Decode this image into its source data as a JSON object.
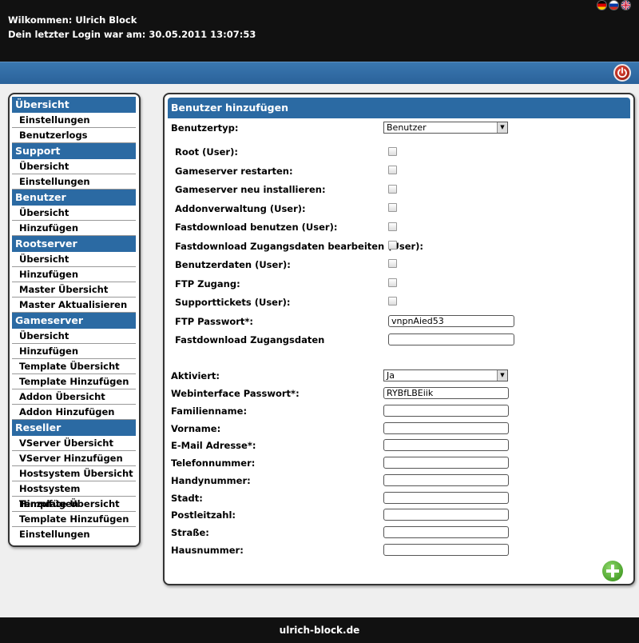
{
  "header": {
    "welcome": "Wilkommen: Ulrich Block",
    "last_login": "Dein letzter Login war am: 30.05.2011 13:07:53"
  },
  "sidebar": {
    "sections": [
      {
        "title": "Übersicht",
        "items": [
          "Einstellungen",
          "Benutzerlogs"
        ]
      },
      {
        "title": "Support",
        "items": [
          "Übersicht",
          "Einstellungen"
        ]
      },
      {
        "title": "Benutzer",
        "items": [
          "Übersicht",
          "Hinzufügen"
        ]
      },
      {
        "title": "Rootserver",
        "items": [
          "Übersicht",
          "Hinzufügen",
          "Master Übersicht",
          "Master Aktualisieren"
        ]
      },
      {
        "title": "Gameserver",
        "items": [
          "Übersicht",
          "Hinzufügen",
          "Template Übersicht",
          "Template Hinzufügen",
          "Addon Übersicht",
          "Addon Hinzufügen"
        ]
      },
      {
        "title": "Reseller",
        "items": [
          "VServer Übersicht",
          "VServer Hinzufügen",
          "Hostsystem Übersicht",
          "Hostsystem Hinzufügen",
          "Template Übersicht",
          "Template Hinzufügen",
          "Einstellungen"
        ]
      }
    ]
  },
  "form": {
    "title": "Benutzer hinzufügen",
    "usertype_label": "Benutzertyp:",
    "usertype_value": "Benutzer",
    "permissions": [
      "Root (User):",
      "Gameserver restarten:",
      "Gameserver neu installieren:",
      "Addonverwaltung (User):",
      "Fastdownload benutzen (User):",
      "Fastdownload Zugangsdaten bearbeiten (User):",
      "Benutzerdaten (User):",
      "FTP Zugang:",
      "Supporttickets (User):"
    ],
    "ftp_password_label": "FTP Passwort*:",
    "ftp_password_value": "vnpnAied53",
    "fastdl_label": "Fastdownload Zugangsdaten",
    "fastdl_value": "",
    "active_label": "Aktiviert:",
    "active_value": "Ja",
    "web_password_label": "Webinterface Passwort*:",
    "web_password_value": "RYBfLBEiik",
    "fields": [
      {
        "label": "Familienname:",
        "value": ""
      },
      {
        "label": "Vorname:",
        "value": ""
      },
      {
        "label": "E-Mail Adresse*:",
        "value": ""
      },
      {
        "label": "Telefonnummer:",
        "value": ""
      },
      {
        "label": "Handynummer:",
        "value": ""
      },
      {
        "label": "Stadt:",
        "value": ""
      },
      {
        "label": "Postleitzahl:",
        "value": ""
      },
      {
        "label": "Straße:",
        "value": ""
      },
      {
        "label": "Hausnummer:",
        "value": ""
      }
    ]
  },
  "footer": {
    "text": "ulrich-block.de"
  },
  "icons": {
    "power": "power-icon",
    "add": "add-icon",
    "flags": [
      "flag-de-icon",
      "flag-ru-icon",
      "flag-gb-icon"
    ]
  }
}
